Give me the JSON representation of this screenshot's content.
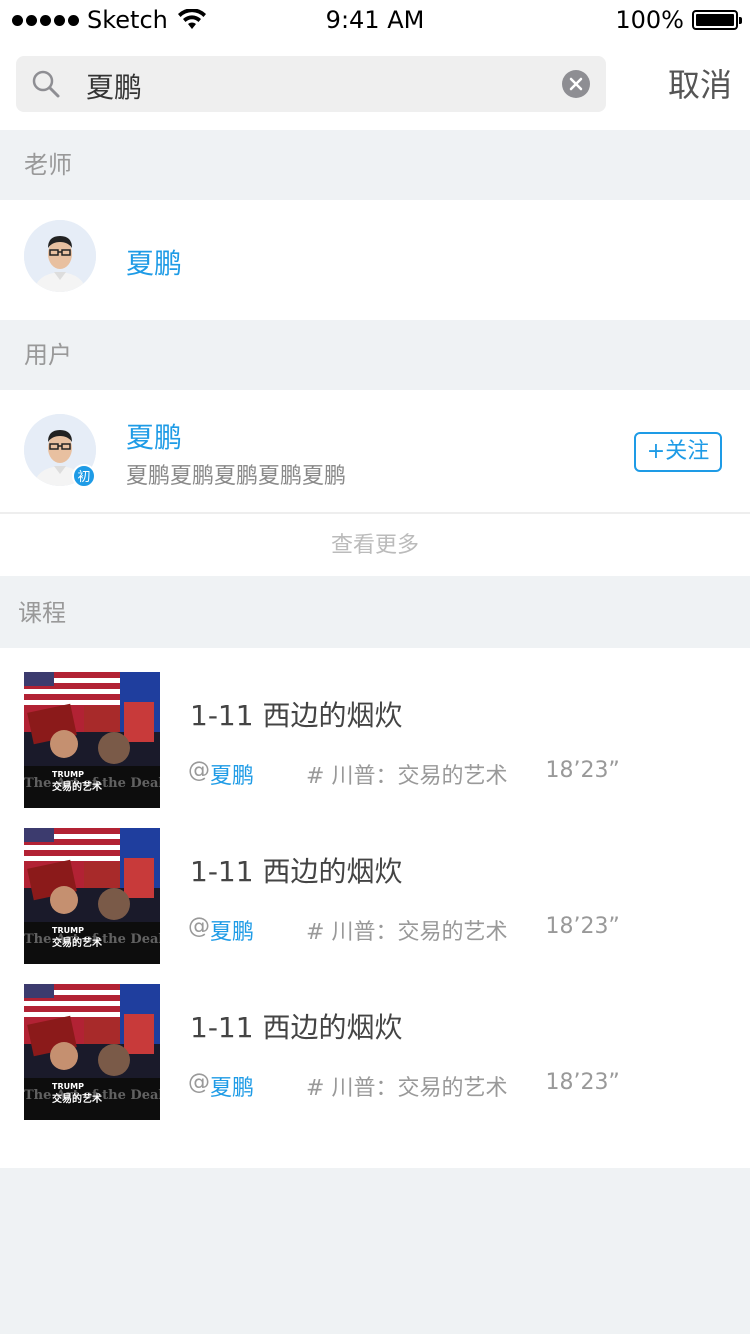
{
  "status_bar": {
    "carrier": "Sketch",
    "time": "9:41 AM",
    "battery": "100%"
  },
  "search": {
    "value": "夏鹏",
    "cancel_label": "取消"
  },
  "sections": {
    "teacher_header": "老师",
    "user_header": "用户",
    "course_header": "课程"
  },
  "teacher": {
    "name": "夏鹏"
  },
  "user": {
    "name": "夏鹏",
    "subtitle": "夏鹏夏鹏夏鹏夏鹏夏鹏",
    "badge": "初",
    "follow_label": "+关注"
  },
  "see_more_label": "查看更多",
  "courses": [
    {
      "title": "1-11 西边的烟炊",
      "at": "@",
      "author": "夏鹏",
      "topic": "# 川普：交易的艺术",
      "duration": "18’23”",
      "thumb_text": {
        "trump": "TRUMP",
        "cn": "交易的艺术",
        "deal": "The Art of the Deal"
      }
    },
    {
      "title": "1-11 西边的烟炊",
      "at": "@",
      "author": "夏鹏",
      "topic": "# 川普：交易的艺术",
      "duration": "18’23”",
      "thumb_text": {
        "trump": "TRUMP",
        "cn": "交易的艺术",
        "deal": "The Art of the Deal"
      }
    },
    {
      "title": "1-11 西边的烟炊",
      "at": "@",
      "author": "夏鹏",
      "topic": "# 川普：交易的艺术",
      "duration": "18’23”",
      "thumb_text": {
        "trump": "TRUMP",
        "cn": "交易的艺术",
        "deal": "The Art of the Deal"
      }
    }
  ],
  "colors": {
    "accent": "#1e9be6",
    "background": "#eff2f4"
  }
}
